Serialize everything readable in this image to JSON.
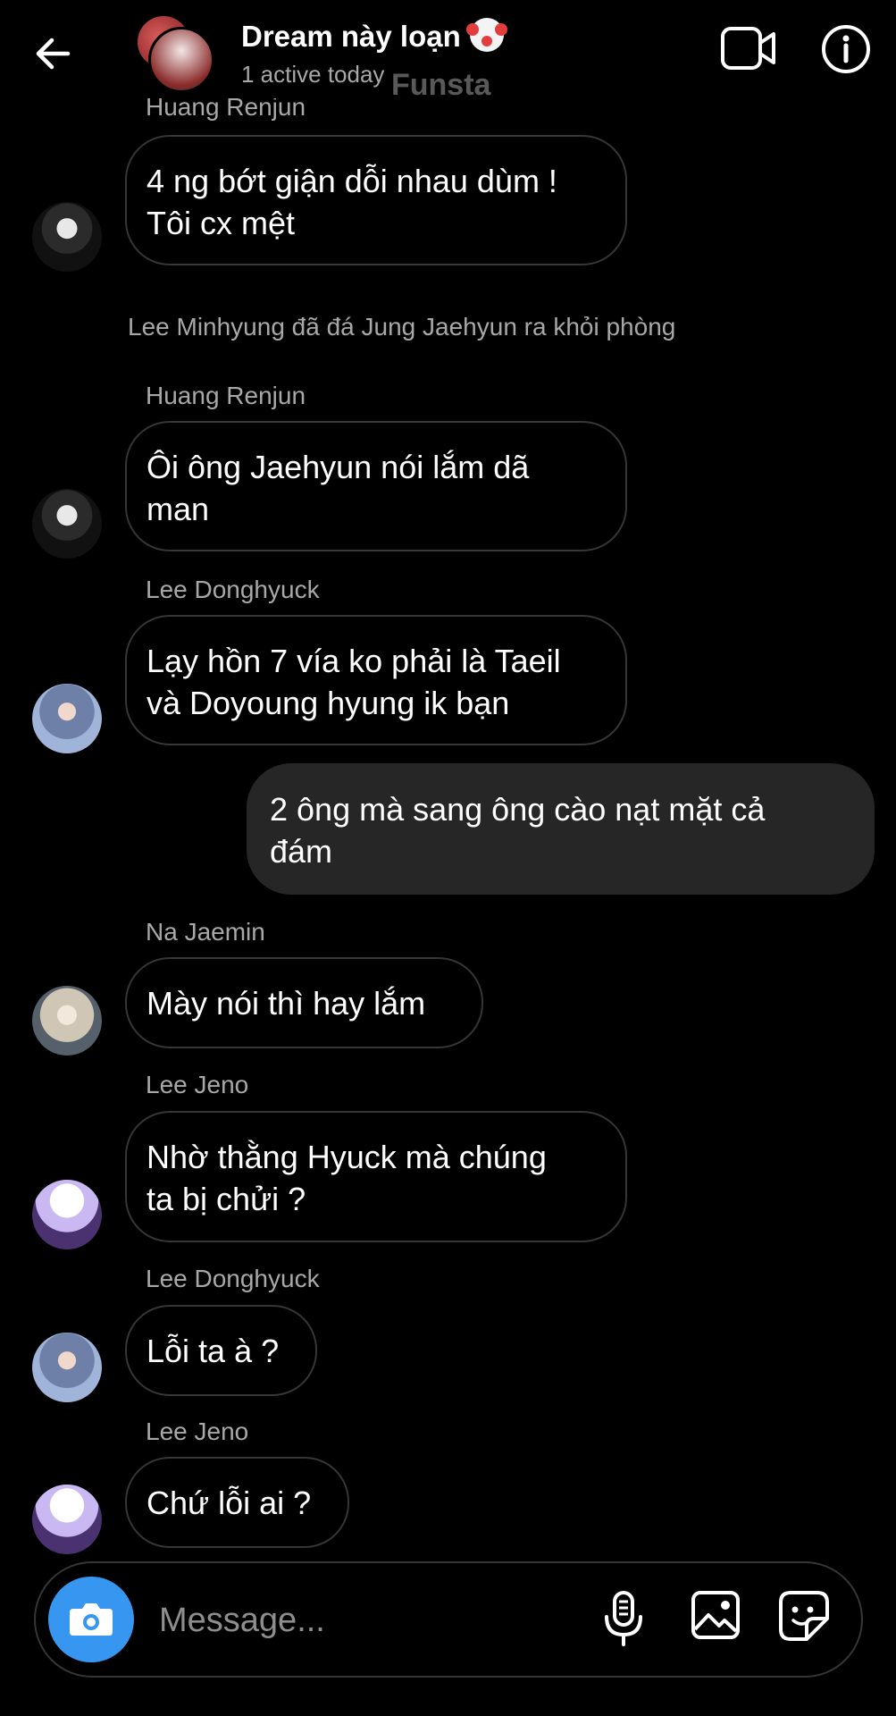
{
  "header": {
    "title": "Dream này loạn",
    "status": "1 active today",
    "watermark": "Funsta"
  },
  "thread": {
    "partial_sender": "Huang Renjun",
    "event_text": "Lee Minhyung đã đá Jung Jaehyun ra khỏi phòng",
    "messages": [
      {
        "sender": "",
        "line1": "4 ng bớt giận dỗi nhau dùm !",
        "line2": "Tôi cx mệt"
      },
      {
        "sender": "Huang Renjun",
        "line1": "Ôi ông Jaehyun nói lắm dã",
        "line2": "man"
      },
      {
        "sender": "Lee Donghyuck",
        "line1": "Lạy hồn 7 vía ko phải là Taeil",
        "line2": "và Doyoung hyung ik bạn"
      },
      {
        "sender": "",
        "line1": "2 ông mà sang ông cào nạt mặt cả",
        "line2": "đám"
      },
      {
        "sender": "Na Jaemin",
        "line1": "Mày nói thì hay lắm",
        "line2": ""
      },
      {
        "sender": "Lee Jeno",
        "line1": "Nhờ thằng Hyuck mà chúng",
        "line2": "ta bị chửi ?"
      },
      {
        "sender": "Lee Donghyuck",
        "line1": "Lỗi ta à ?",
        "line2": ""
      },
      {
        "sender": "Lee Jeno",
        "line1": "Chứ lỗi ai ?",
        "line2": ""
      }
    ]
  },
  "composer": {
    "placeholder": "Message..."
  },
  "icons": [
    "back-arrow-icon",
    "video-call-icon",
    "info-icon",
    "camera-icon",
    "microphone-icon",
    "gallery-icon",
    "sticker-icon"
  ],
  "colors": {
    "background": "#000000",
    "own_bubble": "#262626",
    "bubble_border": "#363636",
    "meta_text": "#a8a8a8",
    "camera_button": "#3797f0"
  }
}
